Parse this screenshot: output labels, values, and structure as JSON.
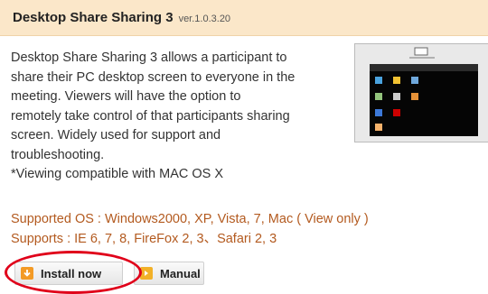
{
  "product": {
    "title": "Desktop Share Sharing 3",
    "version": "ver.1.0.3.20"
  },
  "description": {
    "lines": [
      "Desktop Share Sharing 3 allows a participant to",
      "share their PC desktop screen to everyone in the",
      "meeting. Viewers will have the option to",
      "remotely take control of that participants sharing",
      "screen. Widely used for support and",
      "troubleshooting.",
      "*Viewing compatible with MAC OS X"
    ]
  },
  "compat": {
    "supported_os": "Supported OS : Windows2000, XP, Vista, 7, Mac ( View only )",
    "supports": "Supports : IE 6, 7, 8, FireFox 2, 3、Safari 2, 3"
  },
  "buttons": {
    "install_label": "Install now",
    "manual_label": "Manual"
  },
  "icons": {
    "install": "download-arrow-icon",
    "manual": "manual-doc-icon"
  },
  "colors": {
    "header_bg": "#fbe7c9",
    "os_text": "#b35a1f",
    "highlight_ring": "#e0001a",
    "icon_orange": "#f39a25"
  }
}
